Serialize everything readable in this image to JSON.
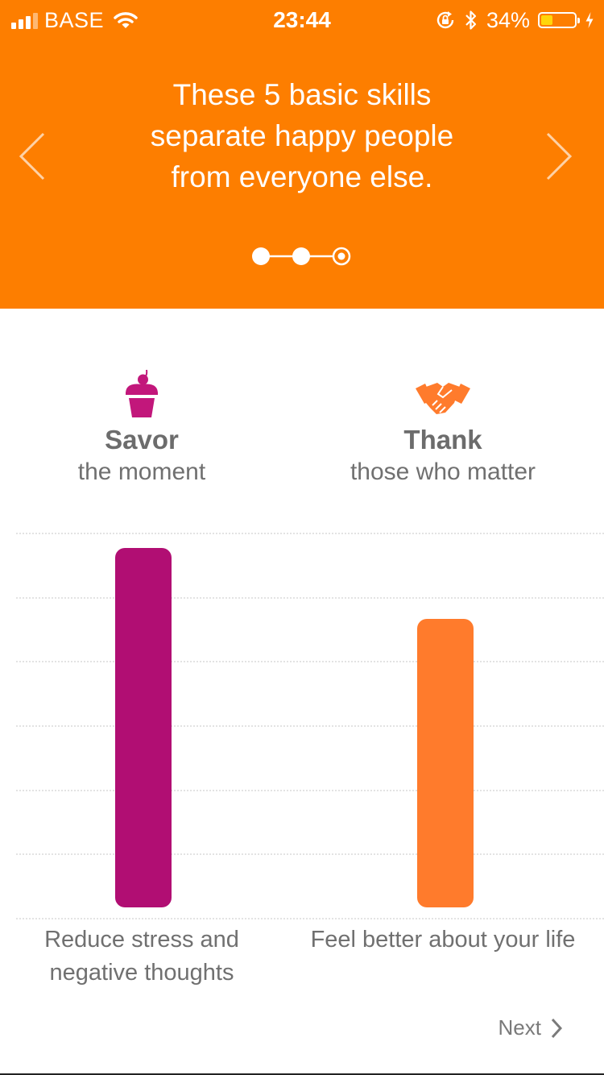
{
  "status_bar": {
    "carrier": "BASE",
    "time": "23:44",
    "battery_percent": "34%",
    "battery_level": 0.34,
    "icons": [
      "signal-icon",
      "wifi-icon",
      "orientation-lock-icon",
      "bluetooth-icon",
      "battery-icon",
      "charging-icon"
    ]
  },
  "header": {
    "background": "#fd7e00",
    "headline": "These 5 basic skills separate happy people from everyone else.",
    "pager": {
      "count": 3,
      "active_index": 2
    }
  },
  "skills": [
    {
      "icon": "cupcake-icon",
      "name": "Savor",
      "description": "the moment",
      "color": "#b10e73"
    },
    {
      "icon": "handshake-icon",
      "name": "Thank",
      "description": "those who matter",
      "color": "#ff7b2c"
    }
  ],
  "chart_data": {
    "type": "bar",
    "categories": [
      "Reduce stress and negative thoughts",
      "Feel better about your life"
    ],
    "values": [
      5.6,
      4.5
    ],
    "ylim": [
      0,
      6
    ],
    "grid": true,
    "colors": [
      "#b10e73",
      "#ff7b2c"
    ]
  },
  "outcomes": [
    "Reduce stress and negative thoughts",
    "Feel better about your life"
  ],
  "footer": {
    "next_label": "Next"
  }
}
